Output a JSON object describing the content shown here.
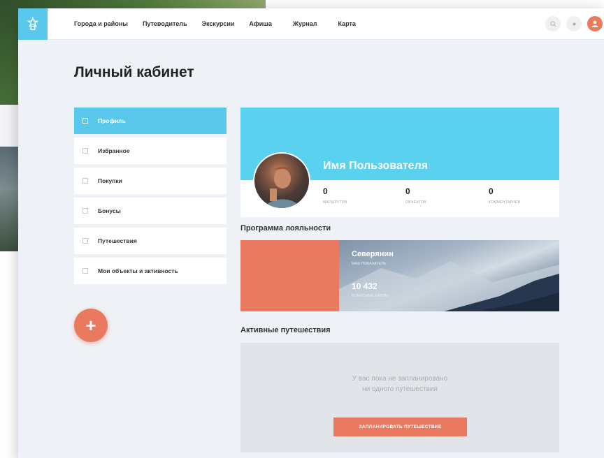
{
  "nav": {
    "items": [
      "Города и районы",
      "Путеводитель",
      "Экскурсии",
      "Афиша",
      "Журнал",
      "Карта"
    ]
  },
  "page": {
    "title": "Личный кабинет"
  },
  "sidebar": {
    "items": [
      {
        "label": "Профиль",
        "active": true
      },
      {
        "label": "Избранное",
        "active": false
      },
      {
        "label": "Покупки",
        "active": false
      },
      {
        "label": "Бонусы",
        "active": false
      },
      {
        "label": "Путешествия",
        "active": false
      },
      {
        "label": "Мои объекты и активность",
        "active": false
      }
    ],
    "fab_label": "+"
  },
  "profile": {
    "name": "Имя Пользователя",
    "stats": [
      {
        "value": "0",
        "label": "МАРШРУТОВ"
      },
      {
        "value": "0",
        "label": "ОБЪЕКТОВ"
      },
      {
        "value": "0",
        "label": "КОММЕНТАРИЕВ"
      }
    ]
  },
  "loyalty": {
    "title": "Программа лояльности",
    "status": "Северянин",
    "status_sub": "ВАШ ПОКАЗАТЕЛЬ",
    "points": "10 432",
    "points_label": "БОНУСНЫЕ БАЛЛЫ"
  },
  "trips": {
    "title": "Активные путешествия",
    "empty_line1": "У вас пока не запланировано",
    "empty_line2": "ни одного путешествия",
    "button_label": "ЗАПЛАНИРОВАТЬ ПУТЕШЕСТВИЕ"
  },
  "colors": {
    "accent": "#59c8eb",
    "orange": "#e97a5f",
    "background": "#eef1f5"
  },
  "icons": {
    "logo": "logo-icon",
    "search": "search-icon",
    "settings": "settings-icon",
    "user": "user-icon",
    "plus": "plus-icon"
  }
}
